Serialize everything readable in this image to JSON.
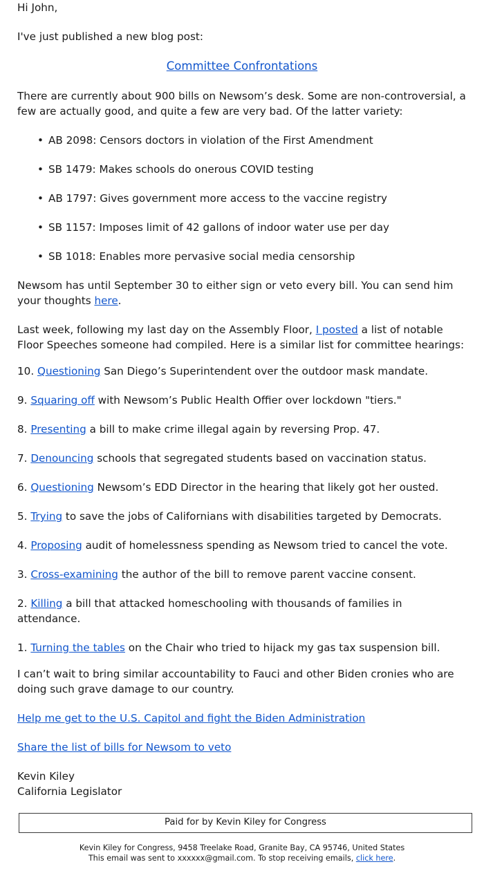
{
  "email": {
    "greeting": "Hi John,",
    "intro": "I've just published a new blog post:",
    "post_title": "Committee Confrontations",
    "lede": "There are currently about 900 bills on Newsom’s desk. Some are non-controversial, a few are actually good, and quite a few are very bad. Of the latter variety:",
    "bills": [
      {
        "bullet": "•",
        "text": "AB 2098: Censors doctors in violation of the First Amendment"
      },
      {
        "bullet": "•",
        "text": "SB 1479: Makes schools do onerous COVID testing"
      },
      {
        "bullet": "•",
        "text": "AB 1797: Gives government more access to the vaccine registry"
      },
      {
        "bullet": "•",
        "text": "SB 1157: Imposes limit of 42 gallons of indoor water use per day"
      },
      {
        "bullet": "•",
        "text": "SB 1018: Enables more pervasive social media censorship"
      }
    ],
    "deadline_before": "Newsom has until September 30 to either sign or veto every bill. You can send him your thoughts ",
    "deadline_link": "here",
    "deadline_after": ".",
    "lastweek_before": "Last week, following my last day on the Assembly Floor, ",
    "lastweek_link": "I posted",
    "lastweek_after": " a list of notable Floor Speeches someone had compiled. Here is a similar list for committee hearings:",
    "ranked": [
      {
        "num": "10. ",
        "link": "Questioning",
        "rest": " San Diego’s Superintendent over the outdoor mask mandate."
      },
      {
        "num": "9. ",
        "link": "Squaring off",
        "rest": " with Newsom’s Public Health Offier over lockdown \"tiers.\""
      },
      {
        "num": "8. ",
        "link": "Presenting",
        "rest": " a bill to make crime illegal again by reversing Prop. 47."
      },
      {
        "num": "7. ",
        "link": "Denouncing",
        "rest": " schools that segregated students based on vaccination status."
      },
      {
        "num": "6. ",
        "link": "Questioning",
        "rest": " Newsom’s EDD Director in the hearing that likely got her ousted."
      },
      {
        "num": "5. ",
        "link": "Trying",
        "rest": " to save the jobs of Californians with disabilities targeted by Democrats."
      },
      {
        "num": "4. ",
        "link": "Proposing",
        "rest": " audit of homelessness spending as Newsom tried to cancel the vote."
      },
      {
        "num": "3. ",
        "link": "Cross-examining",
        "rest": " the author of the bill to remove parent vaccine consent."
      },
      {
        "num": "2. ",
        "link": "Killing",
        "rest": " a bill that attacked homeschooling with thousands of families in attendance."
      },
      {
        "num": "1. ",
        "link": "Turning the tables",
        "rest": " on the Chair who tried to hijack my gas tax suspension bill."
      }
    ],
    "closing": "I can’t wait to bring similar accountability to Fauci and other Biden cronies who are doing such grave damage to our country.",
    "cta_primary": "Help me get to the U.S. Capitol and fight the Biden Administration",
    "cta_secondary": "Share the list of bills for Newsom to veto",
    "signature_name": "Kevin Kiley",
    "signature_title": "California Legislator"
  },
  "disclaimer": {
    "paid_for": "Paid for by Kevin Kiley for Congress"
  },
  "footer": {
    "address": "Kevin Kiley for Congress, 9458 Treelake Road, Granite Bay, CA 95746, United States",
    "unsub_before": "This email was sent to xxxxxx@gmail.com. To stop receiving emails, ",
    "unsub_link": "click here",
    "unsub_after": "."
  },
  "colors": {
    "link": "#1155cc",
    "text": "#1a1a1a",
    "background": "#ffffff",
    "box_border": "#3a3a3a"
  }
}
